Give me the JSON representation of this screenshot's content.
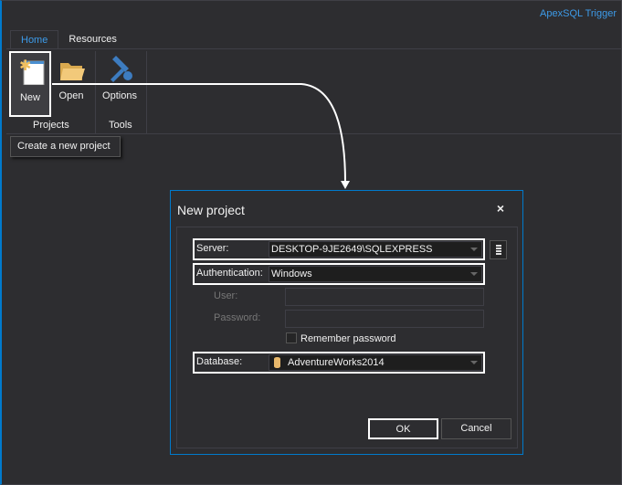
{
  "app_title": "ApexSQL Trigger",
  "tabs": [
    "Home",
    "Resources"
  ],
  "ribbon": {
    "new": "New",
    "open": "Open",
    "options": "Options",
    "group_projects": "Projects",
    "group_tools": "Tools"
  },
  "tooltip": "Create a new project",
  "dialog": {
    "title": "New project",
    "close": "×",
    "server_label": "Server:",
    "server_value": "DESKTOP-9JE2649\\SQLEXPRESS",
    "auth_label": "Authentication:",
    "auth_value": "Windows",
    "user_label": "User:",
    "password_label": "Password:",
    "remember_label": "Remember password",
    "database_label": "Database:",
    "database_value": "AdventureWorks2014",
    "ok": "OK",
    "cancel": "Cancel"
  }
}
